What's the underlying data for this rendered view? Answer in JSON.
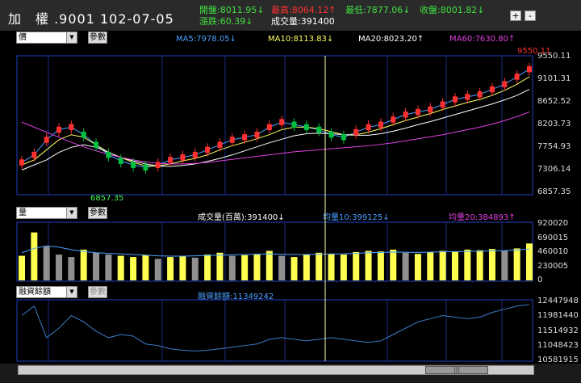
{
  "header": {
    "title": "加　權 .9001 102-07-05",
    "open_label": "開盤:8011.95↓",
    "high_label": "最高:8064.12↑",
    "low_label": "最低:7877.06↓",
    "close_label": "收盤:8001.82↓",
    "change_label": "漲跌:60.39↓",
    "volume_label": "成交量:391400",
    "zoom_in": "+",
    "zoom_out": "-"
  },
  "panels": {
    "price": {
      "select_value": "價",
      "param_button": "參數",
      "legend": {
        "ma5": "MA5:7978.05↓",
        "ma10": "MA10:8113.83↓",
        "ma20": "MA20:8023.20↑",
        "ma60": "MA60:7630.80↑"
      },
      "y_ticks": [
        "9550.11",
        "9101.31",
        "8652.52",
        "8203.73",
        "7754.93",
        "7306.14",
        "6857.35"
      ],
      "high_annotation": "9550.11",
      "low_annotation": "6857.35"
    },
    "volume": {
      "select_value": "量",
      "param_button": "參數",
      "legend": {
        "vol": "成交量(百萬):391400↓",
        "ma10": "均量10:399125↓",
        "ma20": "均量20:384893↑"
      },
      "y_ticks": [
        "920020",
        "690015",
        "460010",
        "230005",
        "0"
      ]
    },
    "margin": {
      "select_value": "融資餘額",
      "param_button": "參數",
      "legend": {
        "balance": "融資餘額:11349242"
      },
      "y_ticks": [
        "12447948",
        "11981440",
        "11514932",
        "11048423",
        "10581915"
      ]
    }
  },
  "colors": {
    "up": "#ff3030",
    "down": "#00c040",
    "ma5": "#4aa0ff",
    "ma10": "#ffff60",
    "ma20": "#ffffff",
    "ma60": "#e040e0",
    "vol_up": "#ffff50",
    "vol_down": "#909090",
    "margin_line": "#3c7cc8",
    "cursor": "#ffffb0",
    "frame": "#2040c0",
    "hilo": "#ff3030",
    "hilo_low": "#40ff40"
  },
  "chart_data": [
    {
      "type": "candlestick",
      "title": "價",
      "y_range": [
        6857.35,
        9550.11
      ],
      "series": [
        {
          "name": "MA5",
          "values": [
            7450,
            7600,
            7900,
            8100,
            8150,
            8000,
            7800,
            7600,
            7480,
            7400,
            7350,
            7400,
            7500,
            7550,
            7600,
            7700,
            7800,
            7900,
            7950,
            8000,
            8150,
            8250,
            8200,
            8150,
            8100,
            8000,
            7950,
            8050,
            8150,
            8200,
            8300,
            8400,
            8450,
            8500,
            8600,
            8700,
            8750,
            8800,
            8900,
            9000,
            9150,
            9300
          ]
        },
        {
          "name": "MA10",
          "values": [
            7400,
            7500,
            7700,
            7900,
            8000,
            7950,
            7800,
            7650,
            7550,
            7450,
            7380,
            7380,
            7420,
            7480,
            7530,
            7600,
            7700,
            7780,
            7850,
            7920,
            8000,
            8100,
            8150,
            8150,
            8120,
            8060,
            8000,
            8000,
            8050,
            8120,
            8200,
            8280,
            8350,
            8420,
            8500,
            8570,
            8640,
            8700,
            8780,
            8880,
            9000,
            9150
          ]
        },
        {
          "name": "MA20",
          "values": [
            7300,
            7400,
            7500,
            7650,
            7750,
            7800,
            7750,
            7650,
            7550,
            7480,
            7420,
            7380,
            7370,
            7390,
            7420,
            7470,
            7530,
            7600,
            7680,
            7760,
            7840,
            7910,
            7980,
            8020,
            8030,
            8020,
            8000,
            7990,
            7990,
            8020,
            8070,
            8130,
            8200,
            8260,
            8330,
            8400,
            8470,
            8540,
            8610,
            8690,
            8780,
            8900
          ]
        },
        {
          "name": "MA60",
          "values": [
            8250,
            8150,
            8050,
            7950,
            7850,
            7760,
            7680,
            7610,
            7550,
            7500,
            7460,
            7430,
            7420,
            7420,
            7430,
            7450,
            7480,
            7510,
            7540,
            7570,
            7600,
            7630,
            7660,
            7680,
            7700,
            7720,
            7740,
            7760,
            7780,
            7810,
            7840,
            7880,
            7920,
            7960,
            8000,
            8050,
            8100,
            8150,
            8210,
            8280,
            8360,
            8450
          ]
        }
      ]
    },
    {
      "type": "bar",
      "title": "量",
      "y_range": [
        0,
        920020
      ],
      "values": [
        400000,
        780000,
        550000,
        420000,
        380000,
        500000,
        450000,
        420000,
        400000,
        380000,
        410000,
        350000,
        380000,
        400000,
        370000,
        420000,
        450000,
        400000,
        410000,
        430000,
        480000,
        400000,
        380000,
        420000,
        450000,
        430000,
        420000,
        460000,
        480000,
        470000,
        500000,
        450000,
        430000,
        460000,
        480000,
        470000,
        500000,
        490000,
        510000,
        480000,
        520000,
        600000
      ],
      "series": [
        {
          "name": "均量10",
          "values": [
            450000,
            520000,
            560000,
            540000,
            500000,
            470000,
            450000,
            440000,
            430000,
            420000,
            410000,
            400000,
            395000,
            395000,
            400000,
            405000,
            410000,
            415000,
            420000,
            425000,
            430000,
            425000,
            420000,
            420000,
            425000,
            430000,
            432000,
            440000,
            450000,
            455000,
            460000,
            458000,
            455000,
            460000,
            465000,
            468000,
            470000,
            475000,
            480000,
            485000,
            495000,
            510000
          ]
        }
      ]
    },
    {
      "type": "line",
      "title": "融資餘額",
      "y_range": [
        10581915,
        12447948
      ],
      "series": [
        {
          "name": "融資餘額",
          "values": [
            12000000,
            12300000,
            11300000,
            11600000,
            12000000,
            11800000,
            11500000,
            11300000,
            11400000,
            11350000,
            11100000,
            11050000,
            10950000,
            10900000,
            10880000,
            10900000,
            10950000,
            11000000,
            11050000,
            11100000,
            11250000,
            11300000,
            11250000,
            11200000,
            11250000,
            11300000,
            11250000,
            11200000,
            11150000,
            11200000,
            11400000,
            11600000,
            11800000,
            11900000,
            12000000,
            11950000,
            11900000,
            11950000,
            12100000,
            12200000,
            12300000,
            12350000
          ]
        }
      ]
    }
  ]
}
